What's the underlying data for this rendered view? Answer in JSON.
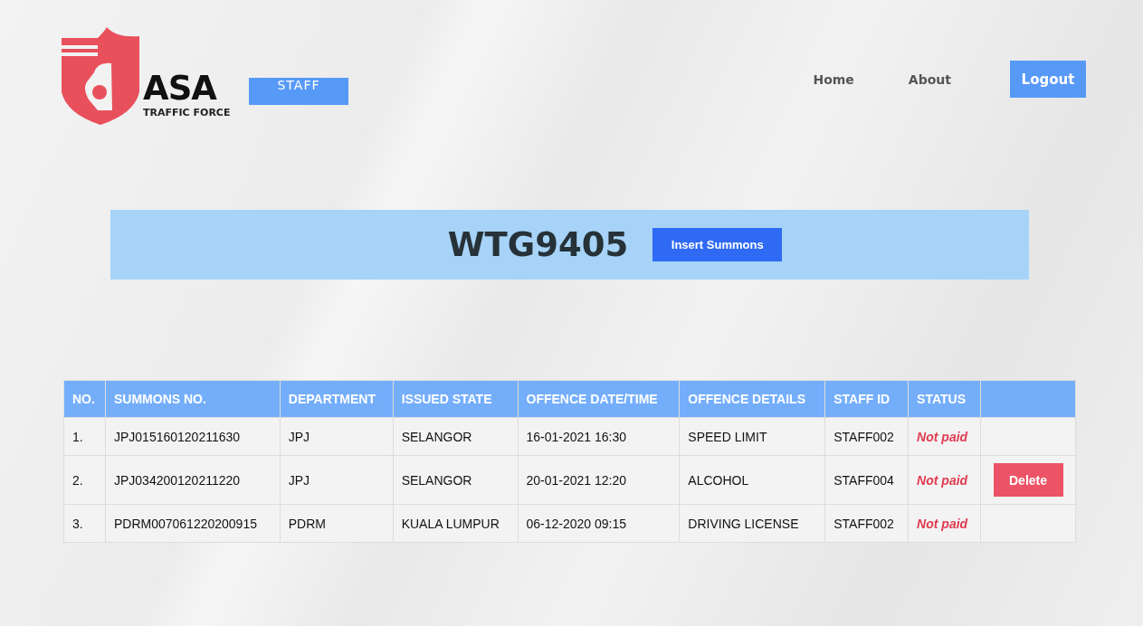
{
  "logo": {
    "name": "ASA",
    "tagline": "TRAFFIC FORCE"
  },
  "role_badge": "STAFF",
  "nav": [
    {
      "label": "Home",
      "kind": "link"
    },
    {
      "label": "About",
      "kind": "link"
    },
    {
      "label": "Logout",
      "kind": "button"
    }
  ],
  "banner": {
    "plate": "WTG9405",
    "button": "Insert Summons"
  },
  "table": {
    "columns": [
      "NO.",
      "SUMMONS NO.",
      "DEPARTMENT",
      "ISSUED STATE",
      "OFFENCE DATE/TIME",
      "OFFENCE DETAILS",
      "STAFF ID",
      "STATUS"
    ],
    "rows": [
      {
        "no": "1.",
        "summons_no": "JPJ015160120211630",
        "department": "JPJ",
        "issued_state": "SELANGOR",
        "offence_datetime": "16-01-2021 16:30",
        "offence_details": "SPEED LIMIT",
        "staff_id": "STAFF002",
        "status": "Not paid"
      },
      {
        "no": "2.",
        "summons_no": "JPJ034200120211220",
        "department": "JPJ",
        "issued_state": "SELANGOR",
        "offence_datetime": "20-01-2021 12:20",
        "offence_details": "ALCOHOL",
        "staff_id": "STAFF004",
        "status": "Not paid",
        "action": "Delete"
      },
      {
        "no": "3.",
        "summons_no": "PDRM007061220200915",
        "department": "PDRM",
        "issued_state": "KUALA LUMPUR",
        "offence_datetime": "06-12-2020 09:15",
        "offence_details": "DRIVING LICENSE",
        "staff_id": "STAFF002",
        "status": "Not paid"
      }
    ]
  }
}
